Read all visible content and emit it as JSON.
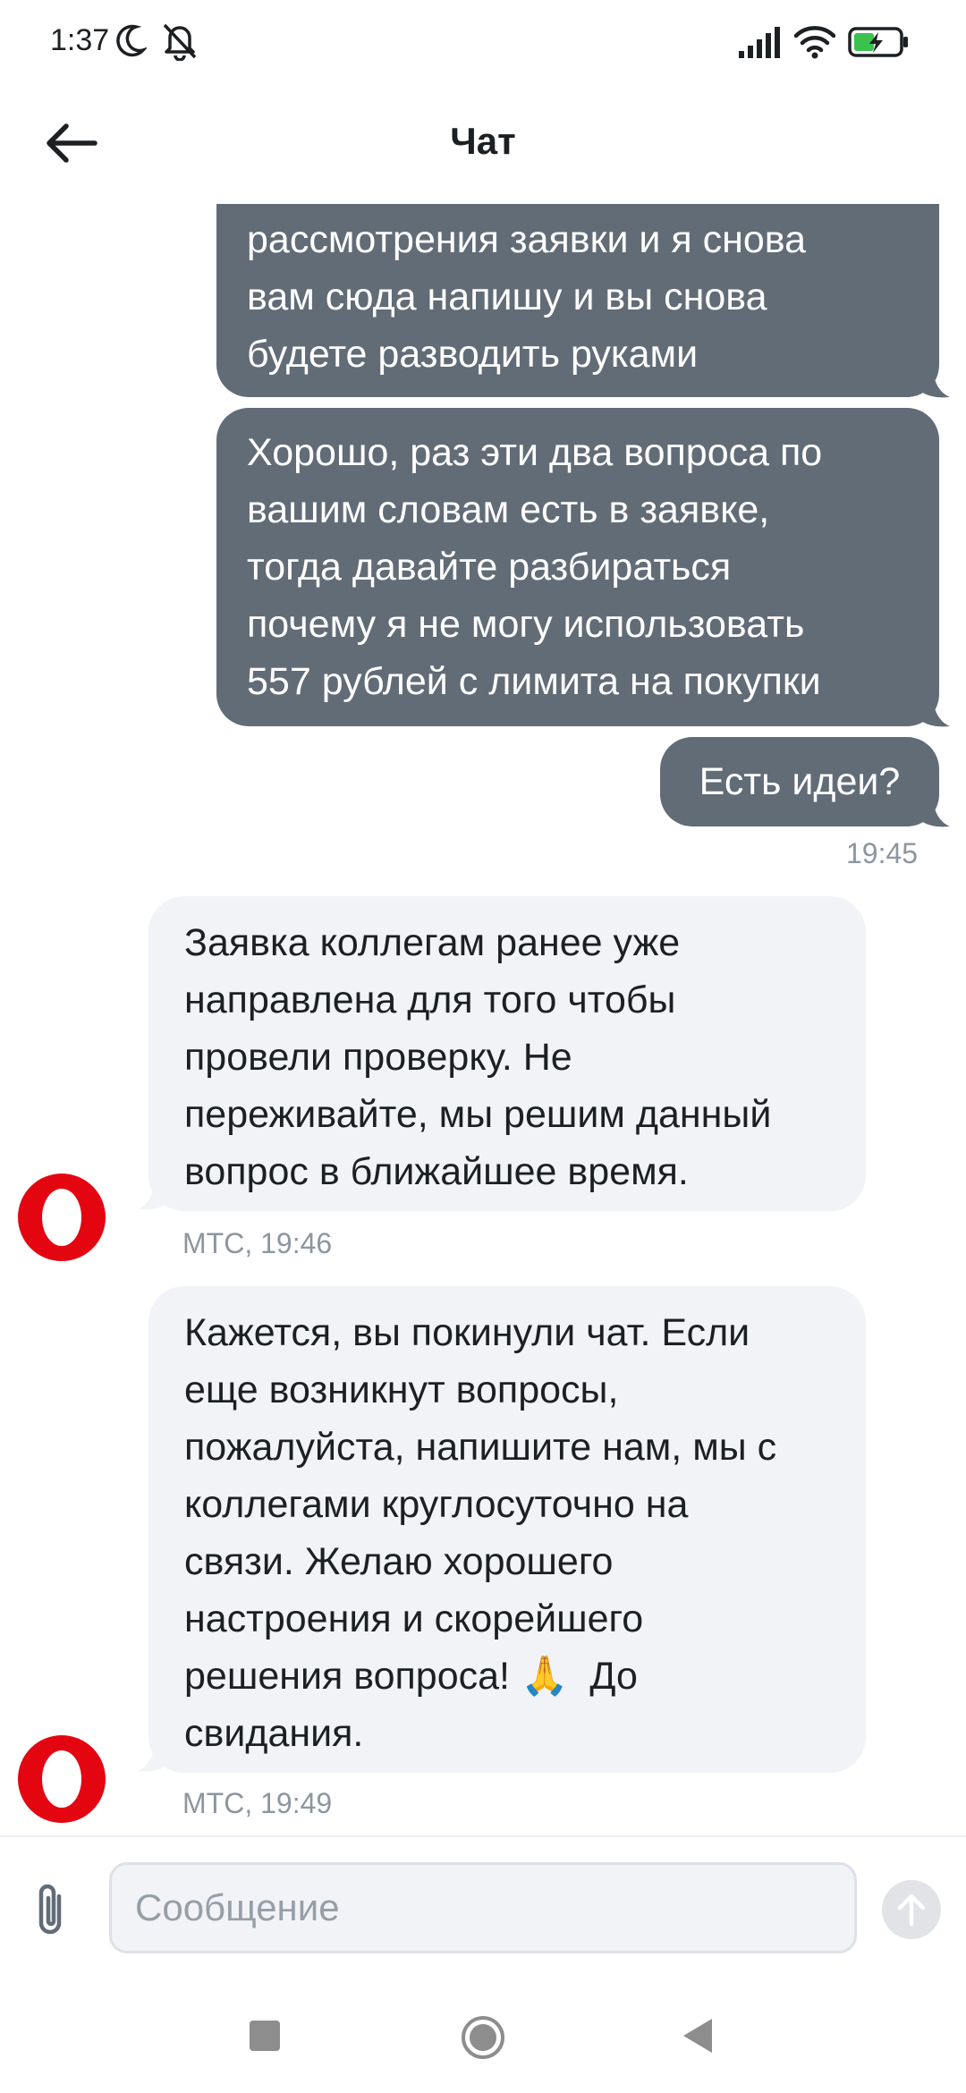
{
  "status_bar": {
    "time": "1:37",
    "icons": [
      "moon-icon",
      "notifications-off-icon",
      "signal-icon",
      "wifi-icon",
      "battery-charging-icon"
    ]
  },
  "header": {
    "title": "Чат",
    "back_icon": "arrow-left-icon"
  },
  "messages": [
    {
      "direction": "out",
      "lines": [
        "рассмотрения заявки и я снова",
        "вам сюда напишу и вы снова",
        "будете разводить руками"
      ]
    },
    {
      "direction": "out",
      "lines": [
        "Хорошо, раз эти два вопроса по",
        "вашим словам есть в заявке,",
        "тогда давайте разбираться",
        "почему я не могу использовать",
        "557 рублей с лимита на покупки"
      ]
    },
    {
      "direction": "out",
      "lines": [
        "Есть идеи?"
      ],
      "time": "19:45"
    },
    {
      "direction": "in",
      "lines": [
        "Заявка коллегам ранее уже",
        "направлена для того чтобы",
        "провели проверку. Не",
        "переживайте, мы решим данный",
        "вопрос в ближайшее время."
      ],
      "meta": "МТС, 19:46"
    },
    {
      "direction": "in",
      "lines": [
        "Кажется, вы покинули чат. Если",
        "еще возникнут вопросы,",
        "пожалуйста, напишите нам, мы с",
        "коллегами круглосуточно на",
        "связи.  Желаю хорошего",
        "настроения и скорейшего"
      ],
      "line_with_emoji": {
        "before": "решения вопроса! ",
        "emoji": "🙏",
        "after": "  До"
      },
      "last_line": "свидания.",
      "meta": "МТС, 19:49"
    }
  ],
  "composer": {
    "placeholder": "Сообщение",
    "value": "",
    "attach_icon": "paperclip-icon",
    "send_icon": "arrow-up-icon"
  },
  "nav_bar": {
    "icons": [
      "recent-apps-icon",
      "home-icon",
      "back-triangle-icon"
    ]
  },
  "colors": {
    "outgoing_bubble": "#626c77",
    "incoming_bubble": "#f2f3f7",
    "brand_red": "#e30611",
    "meta_text": "#8d969f"
  }
}
